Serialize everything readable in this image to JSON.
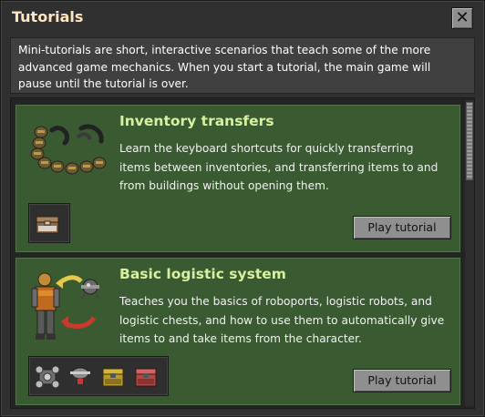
{
  "window": {
    "title": "Tutorials",
    "close_icon": "close-icon"
  },
  "intro": {
    "text": "Mini-tutorials are short, interactive scenarios that teach some of the more advanced game mechanics. When you start a tutorial, the main game will pause until the tutorial is over."
  },
  "tutorials": [
    {
      "title": "Inventory transfers",
      "description": "Learn the keyboard shortcuts for quickly transferring items between inventories, and transferring items to and from buildings without opening them.",
      "button_label": "Play tutorial",
      "illustration_icon": "transport-belt-items-icon",
      "required_items": [
        "wooden-chest-icon"
      ]
    },
    {
      "title": "Basic logistic system",
      "description": "Teaches you the basics of roboports, logistic robots, and logistic chests, and how to use them to automatically give items to and take items from the character.",
      "button_label": "Play tutorial",
      "illustration_icon": "character-with-robot-icon",
      "required_items": [
        "roboport-icon",
        "logistic-robot-icon",
        "storage-chest-icon",
        "active-provider-chest-icon"
      ]
    }
  ],
  "colors": {
    "window_bg": "#313031",
    "title_text": "#ffe6c0",
    "card_bg": "#3a5a32",
    "card_title": "#d7f1a0",
    "button_bg": "#8f8f8f"
  }
}
